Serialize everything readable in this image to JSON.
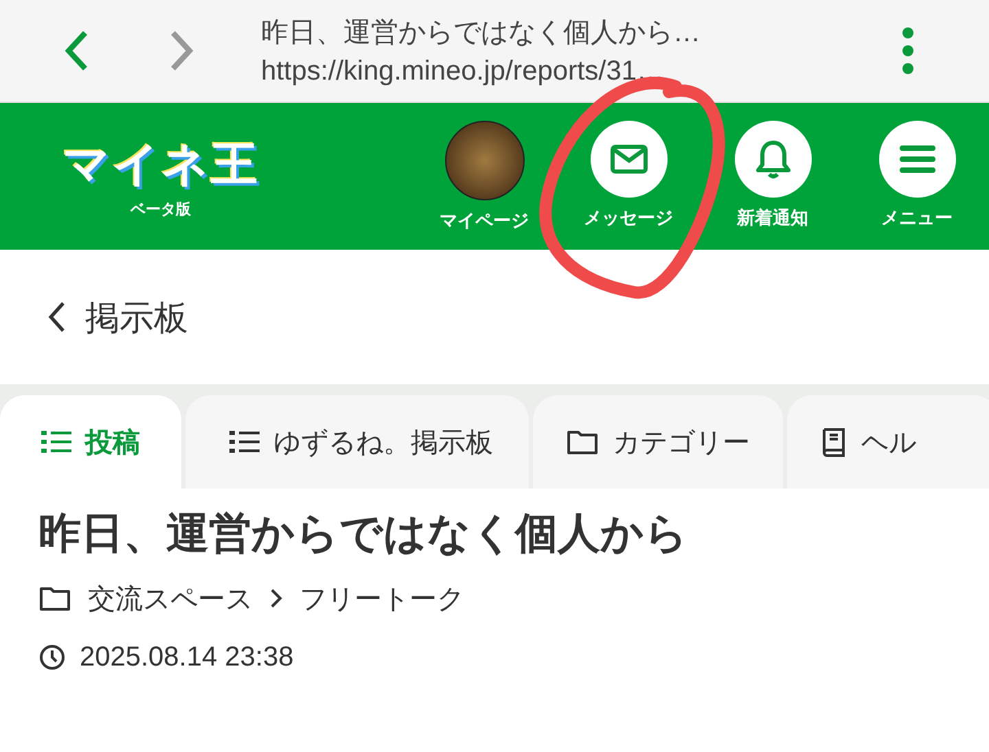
{
  "browser_bar": {
    "page_title": "昨日、運営からではなく個人から…",
    "url": "https://king.mineo.jp/reports/31…",
    "back_enabled": true,
    "forward_enabled": false
  },
  "header": {
    "logo": "マイネ王",
    "logo_sub": "ベータ版",
    "nav": [
      {
        "kind": "avatar",
        "label": "マイページ"
      },
      {
        "kind": "mail",
        "label": "メッセージ"
      },
      {
        "kind": "bell",
        "label": "新着通知"
      },
      {
        "kind": "menu",
        "label": "メニュー"
      }
    ]
  },
  "breadcrumb": {
    "back_label": "掲示板"
  },
  "tabs": [
    {
      "kind": "list",
      "label": "投稿",
      "selected": true
    },
    {
      "kind": "list",
      "label": "ゆずるね。掲示板",
      "selected": false
    },
    {
      "kind": "folder",
      "label": "カテゴリー",
      "selected": false
    },
    {
      "kind": "book",
      "label": "ヘル",
      "selected": false
    }
  ],
  "post": {
    "title": "昨日、運営からではなく個人から",
    "category": "交流スペース",
    "subcategory": "フリートーク",
    "date": "2025.08.14 23:38"
  }
}
